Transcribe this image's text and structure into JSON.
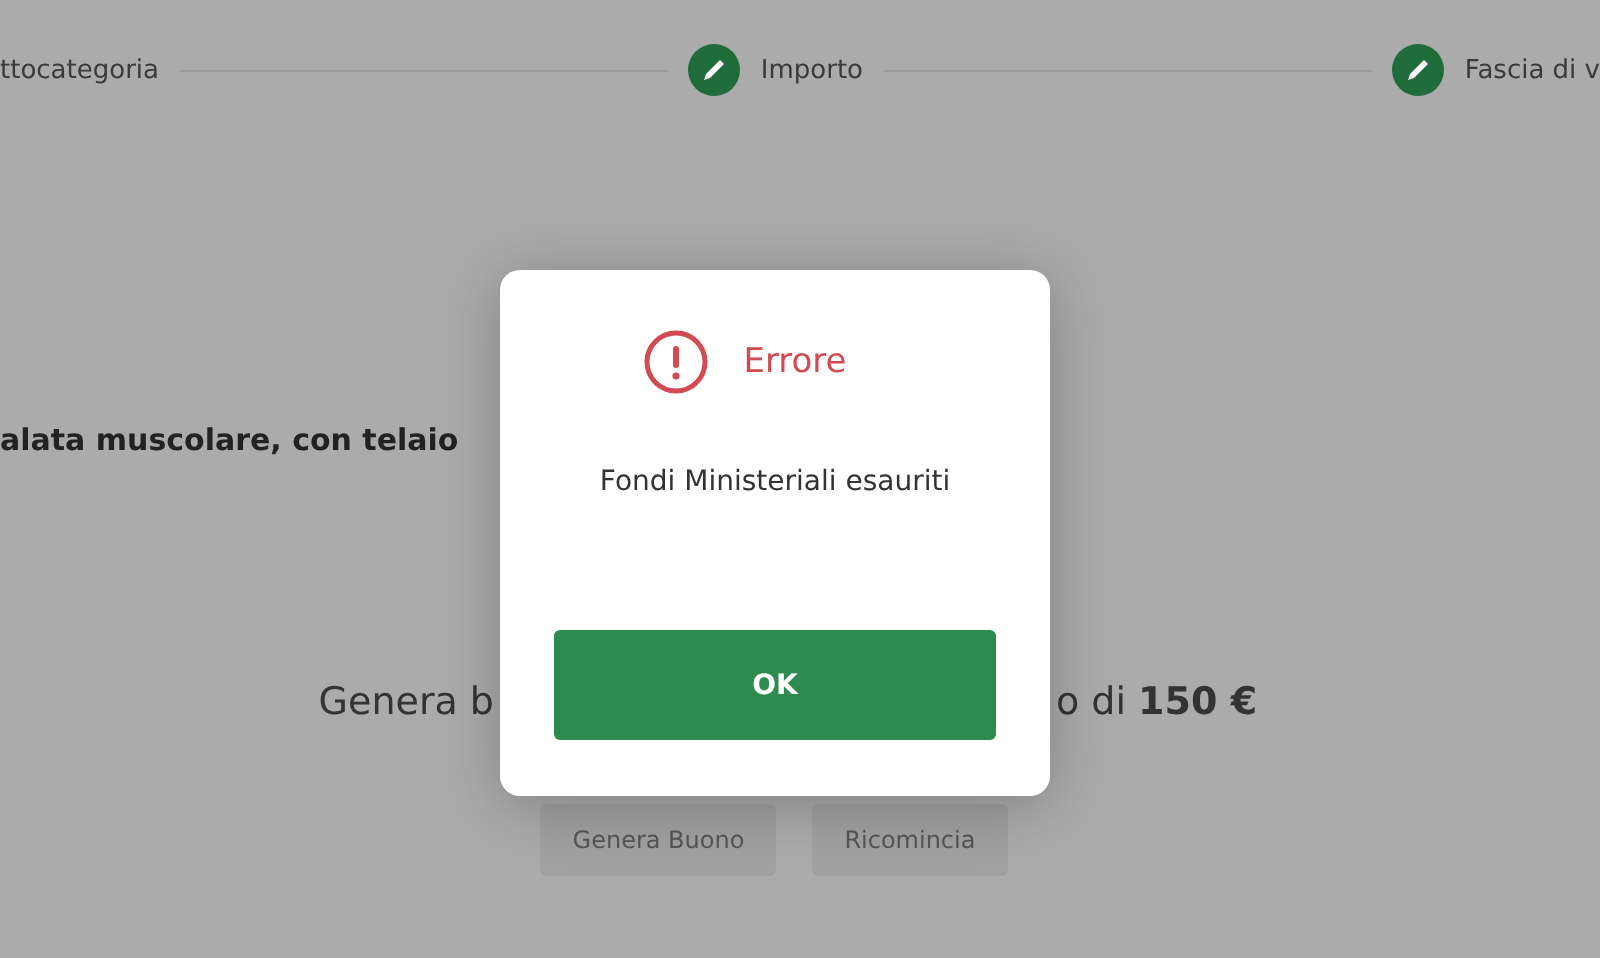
{
  "stepper": {
    "steps": [
      {
        "label": "ttocategoria"
      },
      {
        "label": "Importo"
      },
      {
        "label": "Fascia di v"
      }
    ]
  },
  "product_description": "alata muscolare, con telaio",
  "summary": {
    "left": "Genera b",
    "right": "o di **150 €**"
  },
  "actions": [
    {
      "label": "Genera Buono"
    },
    {
      "label": "Ricomincia"
    }
  ],
  "dialog": {
    "title": "Errore",
    "message": "Fondi Ministeriali esauriti",
    "button": "OK"
  }
}
